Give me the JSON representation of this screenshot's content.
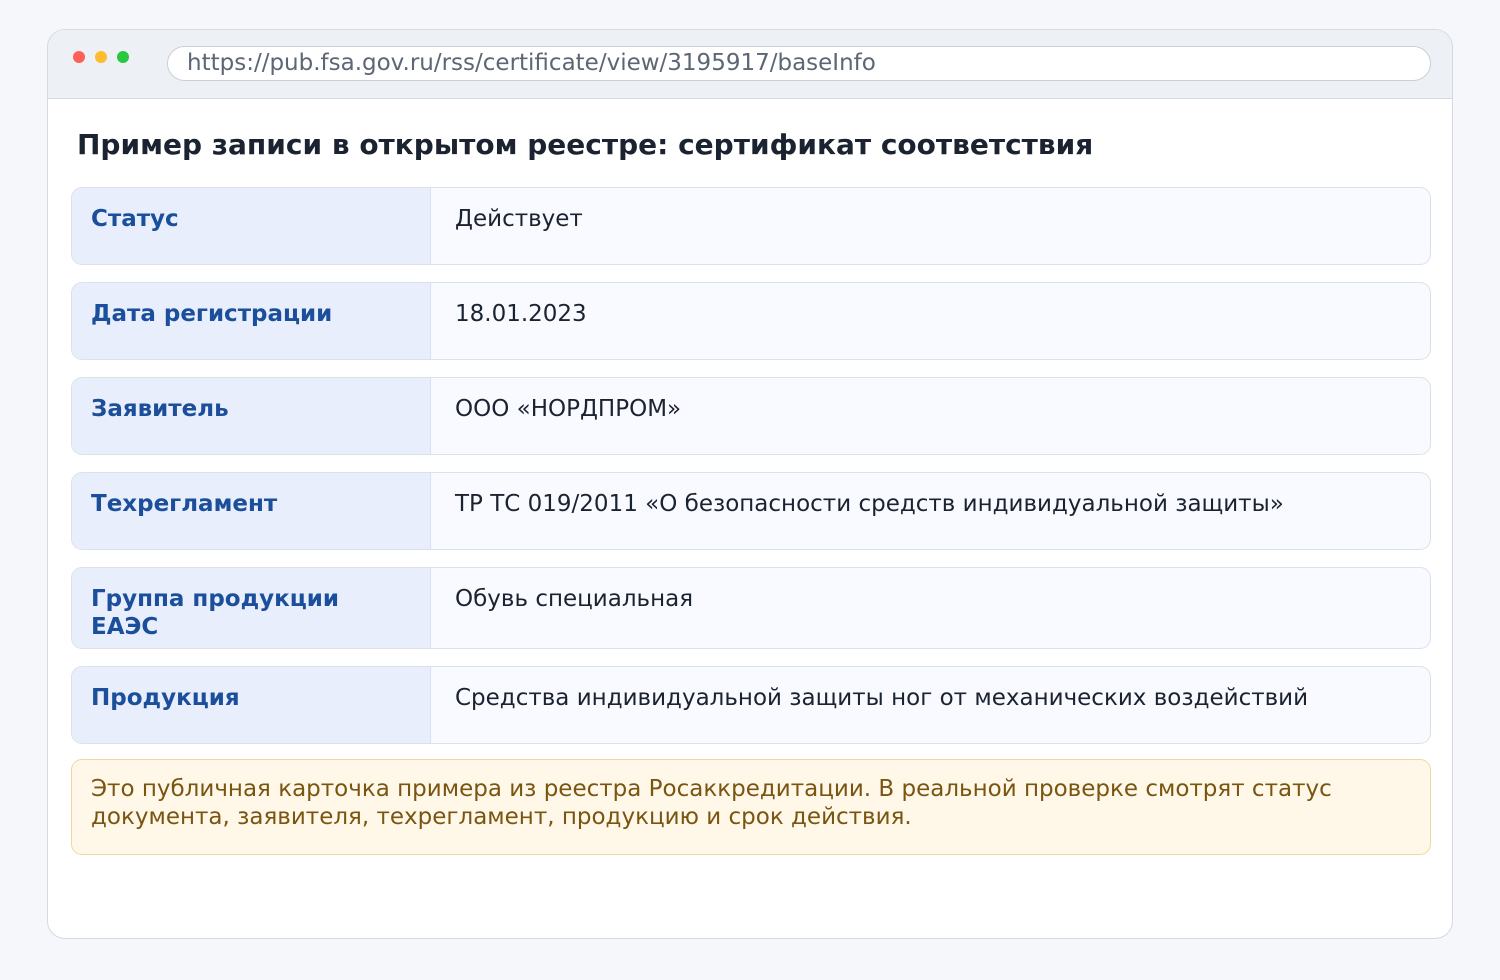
{
  "browser": {
    "url": "https://pub.fsa.gov.ru/rss/certificate/view/3195917/baseInfo",
    "controls": {
      "close_color": "#fe5f57",
      "minimize_color": "#febc2e",
      "maximize_color": "#28c840"
    }
  },
  "page": {
    "title": "Пример записи в открытом реестре: сертификат соответствия"
  },
  "fields": [
    {
      "label": "Статус",
      "value": "Действует"
    },
    {
      "label": "Дата регистрации",
      "value": "18.01.2023"
    },
    {
      "label": "Заявитель",
      "value": "ООО «НОРДПРОМ»"
    },
    {
      "label": "Техрегламент",
      "value": "ТР ТС 019/2011 «О безопасности средств индивидуальной защиты»"
    },
    {
      "label": "Группа продукции ЕАЭС",
      "value": "Обувь специальная"
    },
    {
      "label": "Продукция",
      "value": "Средства индивидуальной защиты ног от механических воздействий"
    }
  ],
  "note": {
    "text": "Это публичная карточка примера из реестра Росаккредитации. В реальной проверке смотрят статус документа, заявителя, техрегламент, продукцию и срок действия."
  },
  "colors": {
    "label_text": "#1b4f9c",
    "label_bg": "#e8eefb",
    "note_bg": "#fff8e8",
    "note_text": "#7a5511"
  }
}
